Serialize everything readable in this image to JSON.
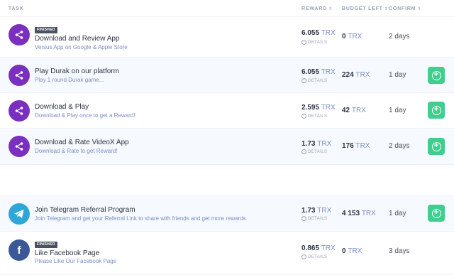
{
  "header": {
    "task": "TASK",
    "reward": "REWARD",
    "budget_left": "BUDGET LEFT",
    "confirm": "CONFIRM",
    "sort_icon": "sort-arrows-icon"
  },
  "colors": {
    "purple": "#7b2fbe",
    "telegram": "#2ea6da",
    "facebook": "#3b5998",
    "green": "#3ecf8e",
    "link": "#7b8ec8"
  },
  "tasks": [
    {
      "badge": "FINISHED",
      "title": "Download and Review App",
      "subtitle": "Versus App on Google & Apple Store",
      "reward": "6.055",
      "currency": "TRX",
      "details": "DETAILS",
      "budget": "0",
      "confirm": "2 days",
      "icon": "share-icon"
    },
    {
      "title": "Play Durak on our platform",
      "subtitle": "Play 1 round Durak game...",
      "reward": "6.055",
      "currency": "TRX",
      "details": "DETAILS",
      "budget": "224",
      "confirm": "1 day",
      "icon": "share-icon"
    },
    {
      "title": "Download & Play",
      "subtitle": "Download & Play once to get a Reward!",
      "reward": "2.595",
      "currency": "TRX",
      "details": "DETAILS",
      "budget": "42",
      "confirm": "1 day",
      "icon": "share-icon"
    },
    {
      "title": "Download & Rate VideoX App",
      "subtitle": "Download & Rate to get Reward!",
      "reward": "1.73",
      "currency": "TRX",
      "details": "DETAILS",
      "budget": "176",
      "confirm": "2 days",
      "icon": "share-icon"
    },
    {
      "title": "Join Telegram Referral Program",
      "subtitle": "Join Telegram and get your Referral Link to share with friends and get more rewards.",
      "reward": "1.73",
      "currency": "TRX",
      "details": "DETAILS",
      "budget": "4 153",
      "confirm": "1 day",
      "icon": "telegram-icon"
    },
    {
      "badge": "FINISHED",
      "title": "Like Facebook Page",
      "subtitle": "Please Like Our Facebook Page",
      "reward": "0.865",
      "currency": "TRX",
      "details": "DETAILS",
      "budget": "0",
      "confirm": "3 days",
      "icon": "facebook-icon"
    }
  ],
  "add_button_icon": "plus-circle-icon"
}
